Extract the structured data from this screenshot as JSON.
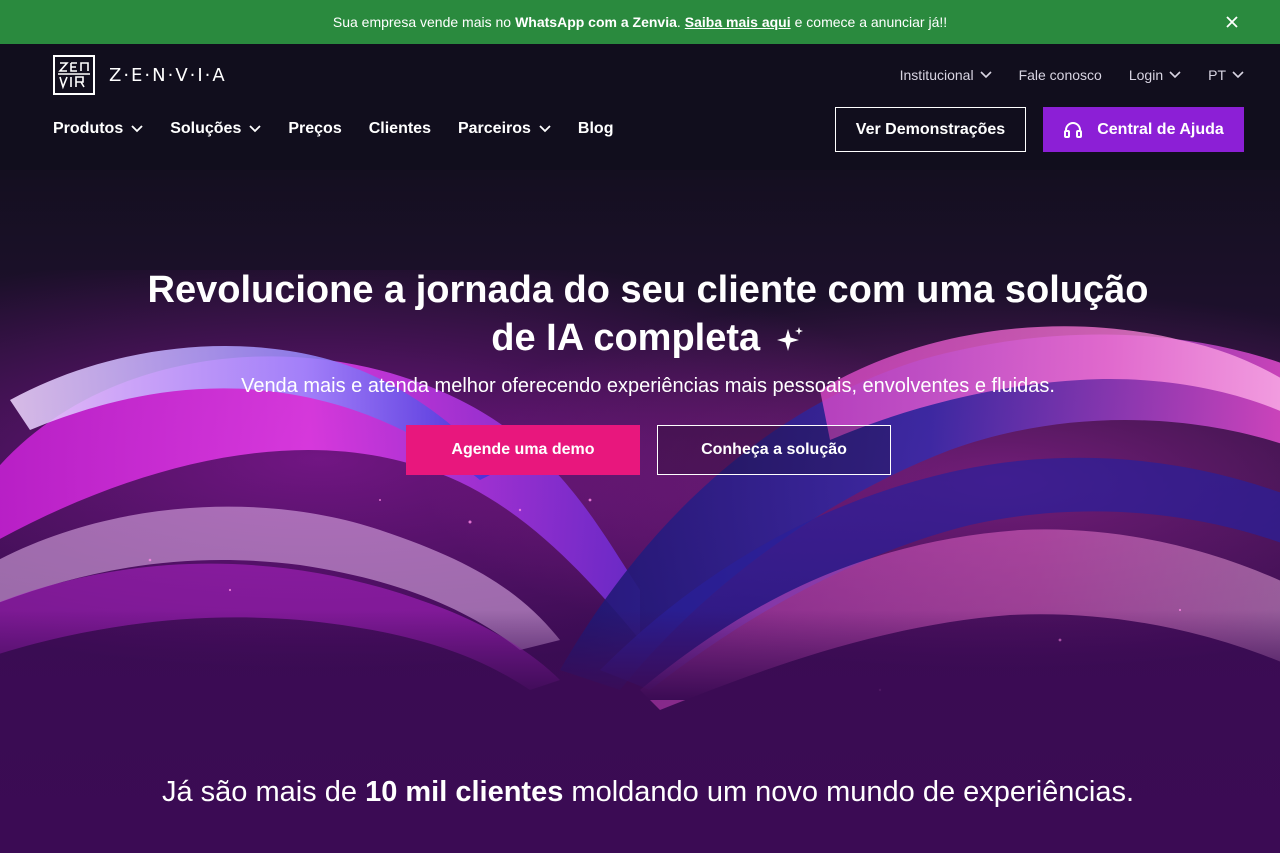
{
  "announcement": {
    "prefix": "Sua empresa vende mais no",
    "bold": "WhatsApp com a Zenvia",
    "dot": ".",
    "link": "Saiba mais aqui",
    "suffix": "e comece a anunciar já!!",
    "close_icon": "close-icon",
    "background": "#2a8a3e"
  },
  "brand": {
    "logo_mark": "ZEN VIA",
    "wordmark": "Z·E·N·V·I·A"
  },
  "util_nav": [
    {
      "label": "Institucional",
      "has_dropdown": true
    },
    {
      "label": "Fale conosco",
      "has_dropdown": false
    },
    {
      "label": "Login",
      "has_dropdown": true
    },
    {
      "label": "PT",
      "has_dropdown": true
    }
  ],
  "main_nav": [
    {
      "label": "Produtos",
      "has_dropdown": true
    },
    {
      "label": "Soluções",
      "has_dropdown": true
    },
    {
      "label": "Preços",
      "has_dropdown": false
    },
    {
      "label": "Clientes",
      "has_dropdown": false
    },
    {
      "label": "Parceiros",
      "has_dropdown": true
    },
    {
      "label": "Blog",
      "has_dropdown": false
    }
  ],
  "header_buttons": {
    "demos": "Ver Demonstrações",
    "help": "Central de Ajuda",
    "help_icon": "headset-icon",
    "help_color": "#8c1fd6"
  },
  "hero": {
    "title_line1": "Revolucione a jornada do seu cliente com uma solução",
    "title_line2": "de IA completa",
    "sparkle_icon": "sparkle-icon",
    "subtitle": "Venda mais e atenda melhor oferecendo experiências mais pessoais, envolventes e fluidas.",
    "primary_cta": "Agende uma demo",
    "secondary_cta": "Conheça a solução",
    "primary_color": "#e8177d"
  },
  "clients": {
    "prefix": "Já são mais de",
    "highlight": "10 mil clientes",
    "suffix": "moldando um novo mundo de experiências."
  }
}
